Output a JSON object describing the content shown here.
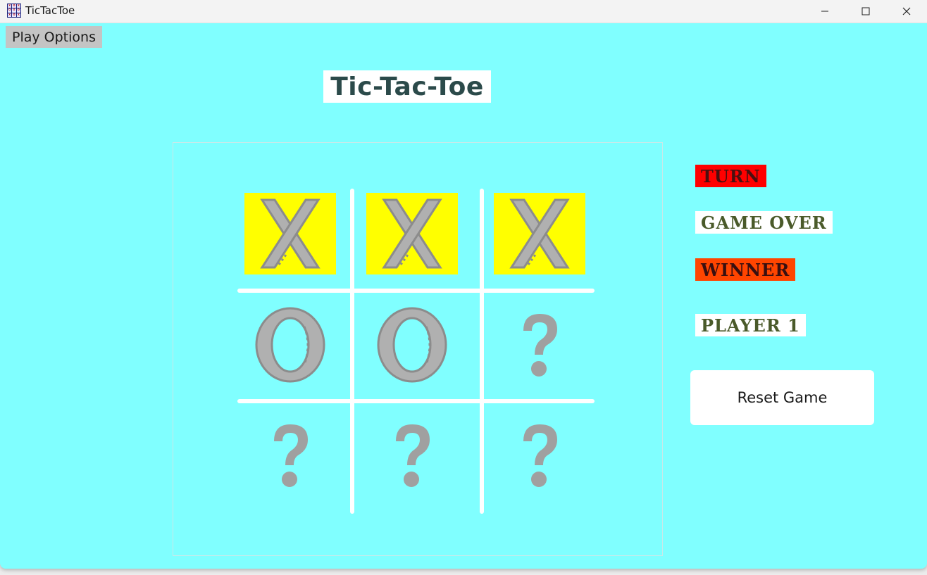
{
  "window": {
    "title": "TicTacToe",
    "controls": [
      "minimize",
      "maximize",
      "close"
    ]
  },
  "menu": {
    "play_options_label": "Play Options"
  },
  "game": {
    "title": "Tic-Tac-Toe",
    "board": [
      [
        "X",
        "X",
        "X"
      ],
      [
        "O",
        "O",
        "?"
      ],
      [
        "?",
        "?",
        "?"
      ]
    ],
    "winning_row": 0
  },
  "status": {
    "turn_label": "TURN",
    "game_over_label": "GAME OVER",
    "winner_label": "WINNER",
    "player_label": "PLAYER 1"
  },
  "actions": {
    "reset_label": "Reset Game"
  },
  "colors": {
    "background": "#80ffff",
    "winning_cell": "#ffff00",
    "turn_badge_bg": "#ff0000",
    "winner_badge_bg": "#ff4500",
    "status_text_dark": "#4a5a2a",
    "symbol_gray": "#a0a0a0"
  }
}
